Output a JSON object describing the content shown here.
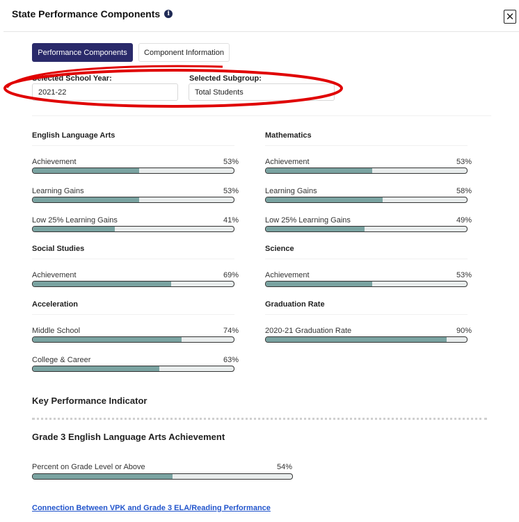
{
  "header": {
    "title": "State Performance Components",
    "info_icon": "info-icon",
    "close_icon": "close-icon"
  },
  "tabs": [
    {
      "label": "Performance Components",
      "active": true
    },
    {
      "label": "Component Information",
      "active": false
    }
  ],
  "selectors": {
    "school_year": {
      "label": "Selected School Year:",
      "value": "2021-22"
    },
    "subgroup": {
      "label": "Selected Subgroup:",
      "value": "Total Students"
    }
  },
  "annotation_color": "#e00000",
  "bar_fill_color": "#7aa3a1",
  "sections": {
    "ela": {
      "title": "English Language Arts",
      "metrics": [
        {
          "label": "Achievement",
          "value": "53%",
          "fraction": 0.53
        },
        {
          "label": "Learning Gains",
          "value": "53%",
          "fraction": 0.53
        },
        {
          "label": "Low 25% Learning Gains",
          "value": "41%",
          "fraction": 0.41
        }
      ]
    },
    "math": {
      "title": "Mathematics",
      "metrics": [
        {
          "label": "Achievement",
          "value": "53%",
          "fraction": 0.53
        },
        {
          "label": "Learning Gains",
          "value": "58%",
          "fraction": 0.58
        },
        {
          "label": "Low 25% Learning Gains",
          "value": "49%",
          "fraction": 0.49
        }
      ]
    },
    "social": {
      "title": "Social Studies",
      "metrics": [
        {
          "label": "Achievement",
          "value": "69%",
          "fraction": 0.69
        }
      ]
    },
    "science": {
      "title": "Science",
      "metrics": [
        {
          "label": "Achievement",
          "value": "53%",
          "fraction": 0.53
        }
      ]
    },
    "acceleration": {
      "title": "Acceleration",
      "metrics": [
        {
          "label": "Middle School",
          "value": "74%",
          "fraction": 0.74
        },
        {
          "label": "College & Career",
          "value": "63%",
          "fraction": 0.63
        }
      ]
    },
    "graduation": {
      "title": "Graduation Rate",
      "metrics": [
        {
          "label": "2020-21 Graduation Rate",
          "value": "90%",
          "fraction": 0.9
        }
      ]
    }
  },
  "kpi": {
    "title": "Key Performance Indicator",
    "grade3_title": "Grade 3 English Language Arts Achievement",
    "metric": {
      "label": "Percent on Grade Level or Above",
      "value": "54%",
      "fraction": 0.54
    }
  },
  "link": {
    "label": "Connection Between VPK and Grade 3 ELA/Reading Performance"
  }
}
